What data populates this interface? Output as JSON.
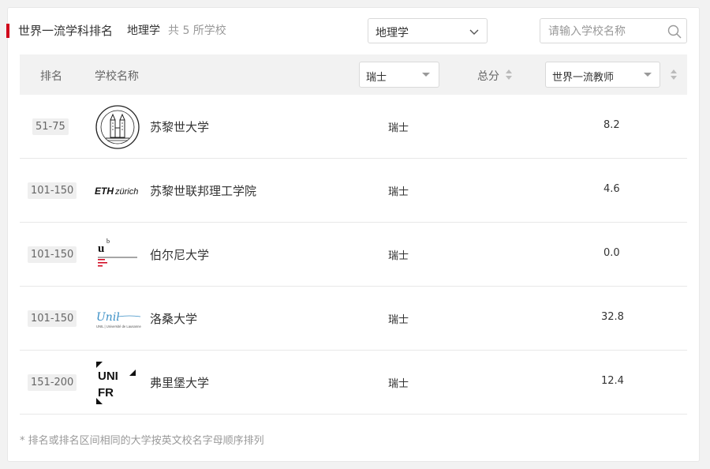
{
  "header": {
    "title": "世界一流学科排名",
    "subject": "地理学",
    "count_text": "共 5 所学校"
  },
  "filters": {
    "subject_value": "地理学",
    "search_placeholder": "请输入学校名称"
  },
  "table": {
    "columns": {
      "rank": "排名",
      "school": "学校名称",
      "country_filter": "瑞士",
      "total": "总分",
      "indicator_filter": "世界一流教师"
    },
    "rows": [
      {
        "rank": "51-75",
        "school": "苏黎世大学",
        "country": "瑞士",
        "score": "8.2",
        "logo": "university-of-zurich-seal"
      },
      {
        "rank": "101-150",
        "school": "苏黎世联邦理工学院",
        "country": "瑞士",
        "score": "4.6",
        "logo": "eth-zurich-wordmark"
      },
      {
        "rank": "101-150",
        "school": "伯尔尼大学",
        "country": "瑞士",
        "score": "0.0",
        "logo": "university-of-bern-logo"
      },
      {
        "rank": "101-150",
        "school": "洛桑大学",
        "country": "瑞士",
        "score": "32.8",
        "logo": "unil-logo"
      },
      {
        "rank": "151-200",
        "school": "弗里堡大学",
        "country": "瑞士",
        "score": "12.4",
        "logo": "unifr-logo"
      }
    ]
  },
  "logos": {
    "eth": "ETH zürich",
    "bern_u": "u",
    "bern_b": "b",
    "unil": "Unil",
    "unil_sub": "UNIL | Université de Lausanne",
    "unifr_1": "UNI",
    "unifr_2": "FR"
  },
  "footer": {
    "note": "* 排名或排名区间相同的大学按英文校名字母顺序排列"
  },
  "colors": {
    "accent": "#d0021b",
    "header_bg": "#f2f2f2",
    "unil_blue": "#3a8fc6"
  }
}
